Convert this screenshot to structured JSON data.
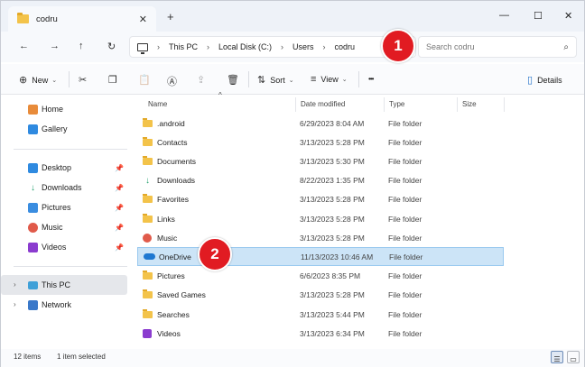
{
  "window": {
    "tab_title": "codru",
    "tab_close": "✕",
    "tab_add": "+",
    "minimize": "—",
    "maximize": "☐",
    "close": "✕"
  },
  "nav": {
    "back": "←",
    "forward": "→",
    "up": "↑",
    "refresh": "↻",
    "breadcrumb": [
      "This PC",
      "Local Disk (C:)",
      "Users",
      "codru"
    ],
    "chevron": "›",
    "search_placeholder": "Search codru",
    "search_icon": "⌕"
  },
  "toolbar": {
    "new_label": "New",
    "new_icon": "⊕",
    "cut_icon": "✂",
    "copy_icon": "❐",
    "paste_icon": "📋",
    "rename_icon": "Ⓐ",
    "share_icon": "⇪",
    "delete_icon": "🗑",
    "sort_label": "Sort",
    "sort_icon": "⇅",
    "view_label": "View",
    "view_icon": "≡",
    "more_icon": "•••",
    "details_label": "Details",
    "details_icon": "▯",
    "caret": "⌄"
  },
  "sidebar": {
    "home": "Home",
    "gallery": "Gallery",
    "quick": [
      {
        "label": "Desktop",
        "color": "#2f8ae0"
      },
      {
        "label": "Downloads",
        "color": "#1e9e6a"
      },
      {
        "label": "Pictures",
        "color": "#3a8de0"
      },
      {
        "label": "Music",
        "color": "#e05a4a"
      },
      {
        "label": "Videos",
        "color": "#8b3ccf"
      }
    ],
    "pin_icon": "📌",
    "this_pc": "This PC",
    "network": "Network",
    "expand_icon": "›"
  },
  "columns": {
    "name": "Name",
    "date": "Date modified",
    "type": "Type",
    "size": "Size",
    "sort_arrow": "^"
  },
  "files": [
    {
      "name": ".android",
      "date": "6/29/2023 8:04 AM",
      "type": "File folder",
      "icon": "folder"
    },
    {
      "name": "Contacts",
      "date": "3/13/2023 5:28 PM",
      "type": "File folder",
      "icon": "folder"
    },
    {
      "name": "Documents",
      "date": "3/13/2023 5:30 PM",
      "type": "File folder",
      "icon": "folder"
    },
    {
      "name": "Downloads",
      "date": "8/22/2023 1:35 PM",
      "type": "File folder",
      "icon": "download"
    },
    {
      "name": "Favorites",
      "date": "3/13/2023 5:28 PM",
      "type": "File folder",
      "icon": "folder"
    },
    {
      "name": "Links",
      "date": "3/13/2023 5:28 PM",
      "type": "File folder",
      "icon": "folder"
    },
    {
      "name": "Music",
      "date": "3/13/2023 5:28 PM",
      "type": "File folder",
      "icon": "music"
    },
    {
      "name": "OneDrive",
      "date": "11/13/2023 10:46 AM",
      "type": "File folder",
      "icon": "cloud",
      "selected": true
    },
    {
      "name": "Pictures",
      "date": "6/6/2023 8:35 PM",
      "type": "File folder",
      "icon": "folder"
    },
    {
      "name": "Saved Games",
      "date": "3/13/2023 5:28 PM",
      "type": "File folder",
      "icon": "folder"
    },
    {
      "name": "Searches",
      "date": "3/13/2023 5:44 PM",
      "type": "File folder",
      "icon": "folder"
    },
    {
      "name": "Videos",
      "date": "3/13/2023 6:34 PM",
      "type": "File folder",
      "icon": "video"
    }
  ],
  "status": {
    "count": "12 items",
    "selected": "1 item selected"
  },
  "badges": {
    "one": "1",
    "two": "2"
  }
}
